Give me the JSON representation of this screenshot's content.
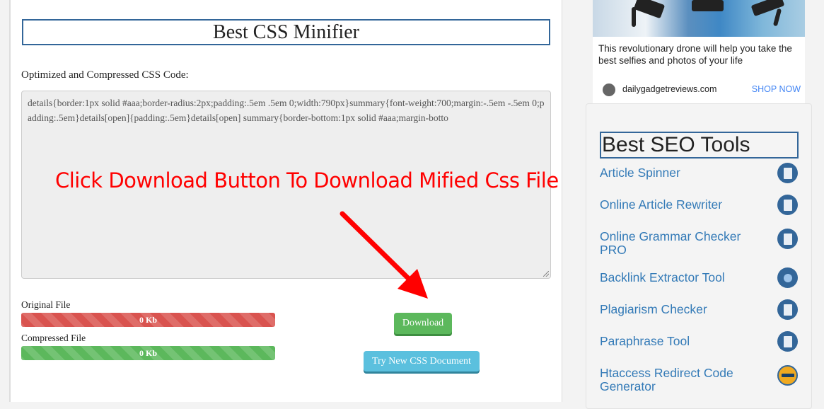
{
  "main": {
    "title": "Best CSS Minifier",
    "output_label": "Optimized and Compressed CSS Code:",
    "output_code": "details{border:1px solid #aaa;border-radius:2px;padding:.5em .5em 0;width:790px}summary{font-weight:700;margin:-.5em -.5em 0;padding:.5em}details[open]{padding:.5em}details[open] summary{border-bottom:1px solid #aaa;margin-botto",
    "original_file": {
      "label": "Original File",
      "value": "0 Kb",
      "color": "#d9534f"
    },
    "compressed_file": {
      "label": "Compressed File",
      "value": "0 Kb",
      "color": "#5cb85c"
    },
    "download_label": "Download",
    "new_doc_label": "Try New CSS Document",
    "annotation": "Click Download Button To Download Mified Css File"
  },
  "ad": {
    "text": "This revolutionary drone will help you take the best selfies and photos of your life",
    "domain": "dailygadgetreviews.com",
    "cta": "SHOP NOW"
  },
  "sidebar": {
    "title": "Best SEO Tools",
    "tools": [
      {
        "label": "Article Spinner",
        "icon": "spinner-doc-icon"
      },
      {
        "label": "Online Article Rewriter",
        "icon": "rewriter-icon"
      },
      {
        "label": "Online Grammar Checker PRO",
        "icon": "grammar-check-icon"
      },
      {
        "label": "Backlink Extractor Tool",
        "icon": "backlink-network-icon"
      },
      {
        "label": "Plagiarism Checker",
        "icon": "magnifier-doc-icon"
      },
      {
        "label": "Paraphrase Tool",
        "icon": "pen-doc-icon"
      },
      {
        "label": "Htaccess Redirect Code Generator",
        "icon": "redirect-refresh-icon"
      }
    ]
  }
}
